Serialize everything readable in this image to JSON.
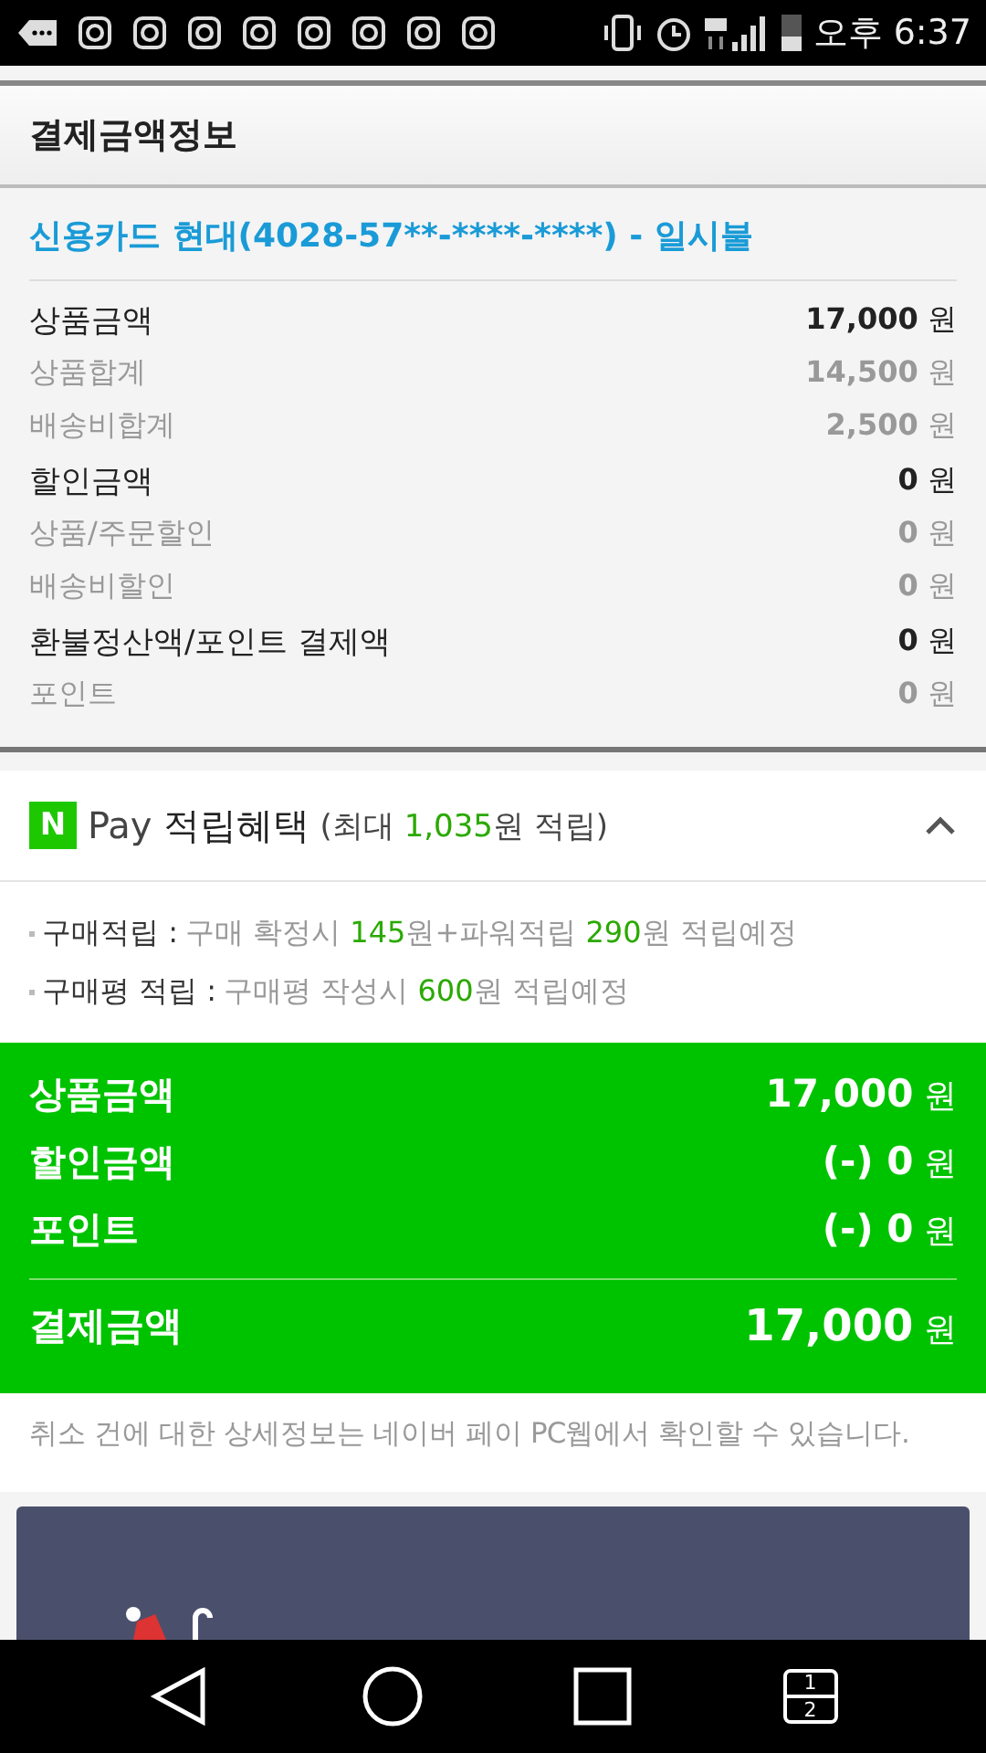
{
  "status_bar": {
    "time": "오후 6:37"
  },
  "section_title": "결제금액정보",
  "card": "신용카드 현대(4028-57**-****-****) - 일시불",
  "amounts": [
    {
      "kind": "main",
      "label": "상품금액",
      "value": "17,000",
      "unit": "원"
    },
    {
      "kind": "sub",
      "label": "상품합계",
      "value": "14,500",
      "unit": "원"
    },
    {
      "kind": "sub",
      "label": "배송비합계",
      "value": "2,500",
      "unit": "원"
    },
    {
      "kind": "main",
      "label": "할인금액",
      "value": "0",
      "unit": "원"
    },
    {
      "kind": "sub",
      "label": "상품/주문할인",
      "value": "0",
      "unit": "원"
    },
    {
      "kind": "sub",
      "label": "배송비할인",
      "value": "0",
      "unit": "원"
    },
    {
      "kind": "main",
      "label": "환불정산액/포인트 결제액",
      "value": "0",
      "unit": "원"
    },
    {
      "kind": "sub",
      "label": "포인트",
      "value": "0",
      "unit": "원"
    }
  ],
  "pay": {
    "logo": "N",
    "brand": "Pay",
    "title": "적립혜택",
    "subtitle": "(최대 **1,035**원 적립)",
    "expanded": true,
    "items": [
      {
        "label": "구매적립 :",
        "text": "구매 확정시 **145**원+파워적립 **290**원 적립예정"
      },
      {
        "label": "구매평 적립 :",
        "text": "구매평 작성시 **600**원 적립예정"
      }
    ]
  },
  "summary": [
    {
      "kind": "item",
      "label": "상품금액",
      "value": "17,000",
      "unit": "원"
    },
    {
      "kind": "item",
      "label": "할인금액",
      "value": "(-) 0",
      "unit": "원"
    },
    {
      "kind": "item",
      "label": "포인트",
      "value": "(-) 0",
      "unit": "원"
    },
    {
      "kind": "total",
      "label": "결제금액",
      "value": "17,000",
      "unit": "원"
    }
  ],
  "notice": "취소 건에 대한 상세정보는 네이버 페이 PC웹에서 확인할 수 있습니다.",
  "nav": {
    "split_labels": [
      "1",
      "2"
    ]
  }
}
